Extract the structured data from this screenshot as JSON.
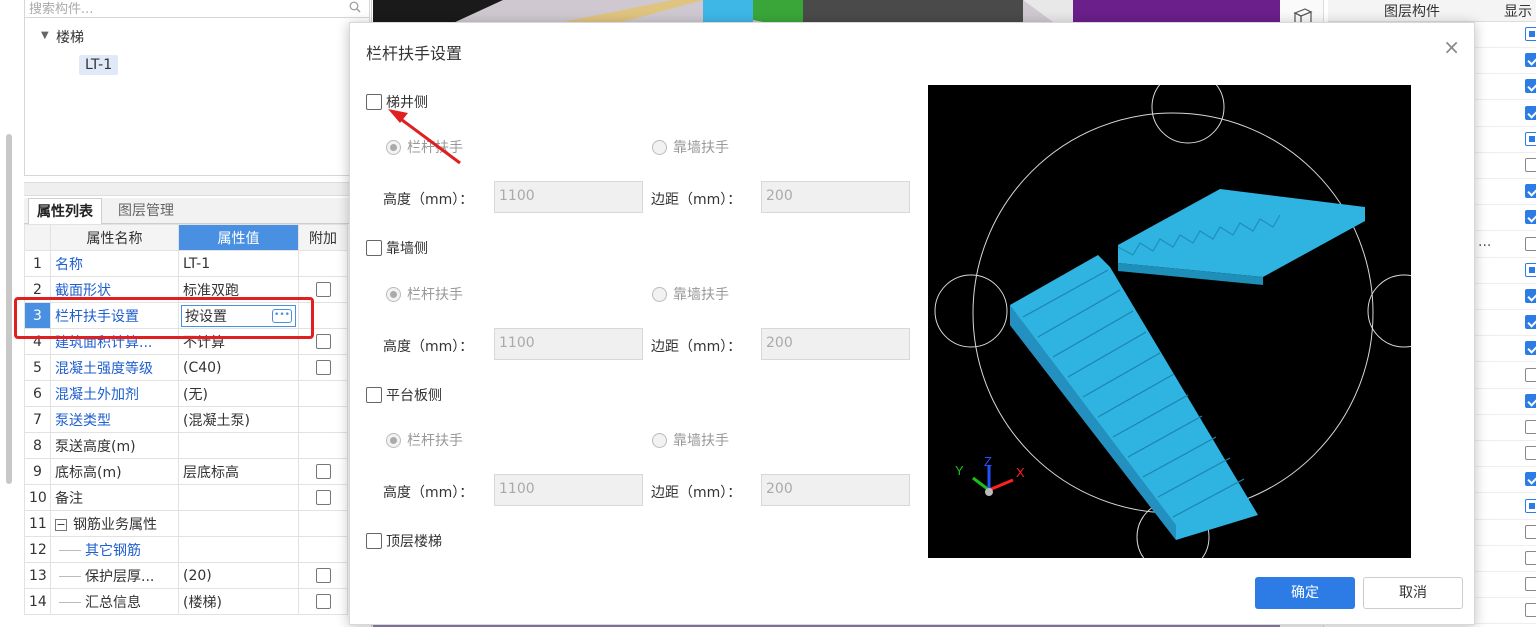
{
  "left": {
    "search_placeholder": "搜索构件...",
    "tree_root": "楼梯",
    "tree_child": "LT-1",
    "tabs": [
      "属性列表",
      "图层管理"
    ],
    "table_headers": [
      "属性名称",
      "属性值",
      "附加"
    ],
    "rows": [
      {
        "num": "1",
        "name": "名称",
        "value": "LT-1",
        "link": true,
        "check": false
      },
      {
        "num": "2",
        "name": "截面形状",
        "value": "标准双跑",
        "link": true,
        "check": true
      },
      {
        "num": "3",
        "name": "栏杆扶手设置",
        "value": "按设置",
        "link": true,
        "check": false
      },
      {
        "num": "4",
        "name": "建筑面积计算...",
        "value": "不计算",
        "link": true,
        "check": true
      },
      {
        "num": "5",
        "name": "混凝土强度等级",
        "value": "(C40)",
        "link": true,
        "check": true
      },
      {
        "num": "6",
        "name": "混凝土外加剂",
        "value": "(无)",
        "link": true,
        "check": false
      },
      {
        "num": "7",
        "name": "泵送类型",
        "value": "(混凝土泵)",
        "link": true,
        "check": false
      },
      {
        "num": "8",
        "name": "泵送高度(m)",
        "value": "",
        "link": false,
        "check": false
      },
      {
        "num": "9",
        "name": "底标高(m)",
        "value": "层底标高",
        "link": false,
        "check": true
      },
      {
        "num": "10",
        "name": "备注",
        "value": "",
        "link": false,
        "check": true
      },
      {
        "num": "11",
        "name": "钢筋业务属性",
        "value": "",
        "link": false,
        "check": false
      },
      {
        "num": "12",
        "name": "其它钢筋",
        "value": "",
        "link": true,
        "check": false
      },
      {
        "num": "13",
        "name": "保护层厚...",
        "value": "(20)",
        "link": false,
        "check": true
      },
      {
        "num": "14",
        "name": "汇总信息",
        "value": "(楼梯)",
        "link": false,
        "check": true
      }
    ]
  },
  "right": {
    "header_layer": "图层构件",
    "header_show": "显示",
    "ellipsis": "..."
  },
  "dialog": {
    "title": "栏杆扶手设置",
    "close": "×",
    "sections": [
      {
        "label": "梯井侧",
        "radio1": "栏杆扶手",
        "radio2": "靠墙扶手",
        "height_label": "高度（mm）：",
        "height_value": "1100",
        "margin_label": "边距（mm）：",
        "margin_value": "200"
      },
      {
        "label": "靠墙侧",
        "radio1": "栏杆扶手",
        "radio2": "靠墙扶手",
        "height_label": "高度（mm）：",
        "height_value": "1100",
        "margin_label": "边距（mm）：",
        "margin_value": "200"
      },
      {
        "label": "平台板侧",
        "radio1": "栏杆扶手",
        "radio2": "靠墙扶手",
        "height_label": "高度（mm）：",
        "height_value": "1100",
        "margin_label": "边距（mm）：",
        "margin_value": "200"
      }
    ],
    "top_stair_label": "顶层楼梯",
    "ok": "确定",
    "cancel": "取消",
    "axis_x": "X",
    "axis_y": "Y",
    "axis_z": "Z",
    "colors": {
      "accent": "#2d7be5",
      "stair": "#2fb3e0",
      "highlight": "#e02020"
    }
  }
}
